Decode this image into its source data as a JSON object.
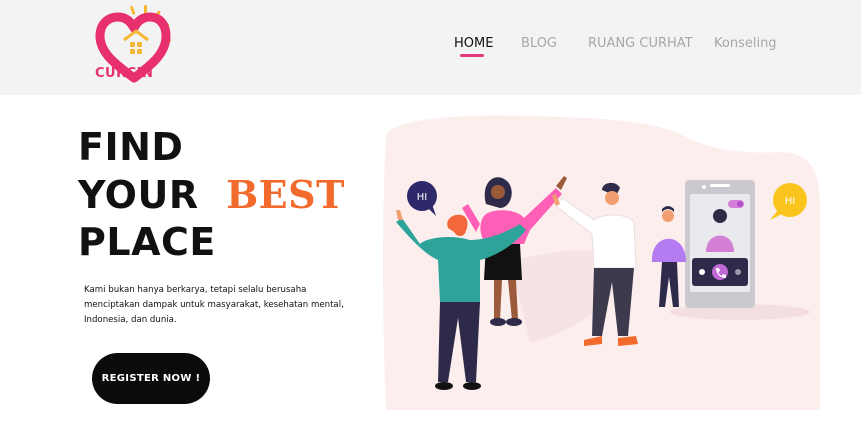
{
  "brand": {
    "name": "CURCIN"
  },
  "nav": {
    "items": [
      {
        "label": "HOME",
        "active": true
      },
      {
        "label": "BLOG",
        "active": false
      },
      {
        "label": "RUANG CURHAT",
        "active": false
      },
      {
        "label": "Konseling",
        "active": false
      }
    ]
  },
  "hero": {
    "title_line1": "FIND",
    "title_line2_a": "YOUR",
    "title_line2_b": "BEST",
    "title_line3": "PLACE",
    "description": "Kami bukan hanya berkarya, tetapi selalu berusaha menciptakan dampak untuk masyarakat, kesehatan mental, Indonesia, dan dunia.",
    "cta_label": "REGISTER NOW !"
  },
  "illustration": {
    "bubble_left": "HI",
    "bubble_right": "HI"
  },
  "colors": {
    "accent_orange": "#f26a2c",
    "brand_pink": "#e8306c",
    "nav_active_underline": "#e03a7c",
    "header_bg": "#f3f3f3",
    "illustration_bg": "#fdeeee"
  },
  "icons": [
    "heart-house-logo-icon",
    "phone-call-icon"
  ]
}
